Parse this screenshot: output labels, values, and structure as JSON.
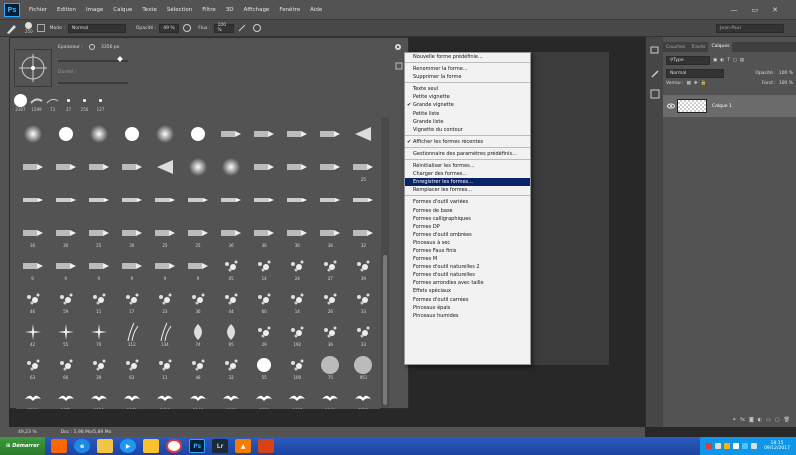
{
  "menubar": {
    "logo": "Ps",
    "items": [
      "Fichier",
      "Edition",
      "Image",
      "Calque",
      "Texte",
      "Sélection",
      "Filtre",
      "3D",
      "Affichage",
      "Fenêtre",
      "Aide"
    ],
    "window_buttons": [
      "—",
      "▭",
      "✕"
    ]
  },
  "options": {
    "brush_size": "250",
    "mode_label": "Mode :",
    "mode_value": "Normal",
    "opacity_label": "Opacité :",
    "opacity_value": "49 %",
    "flow_label": "Flux :",
    "flow_value": "100 %",
    "user": "Jean-Paul"
  },
  "brush_panel": {
    "size_label": "Epaisseur :",
    "size_value": "3356 px",
    "hardness_label": "Dureté :",
    "recent_sizes": [
      "2307",
      "1599",
      "73",
      "27",
      "256",
      "127"
    ]
  },
  "brush_grid": [
    {
      "kind": "soft",
      "num": ""
    },
    {
      "kind": "hard",
      "num": ""
    },
    {
      "kind": "soft",
      "num": ""
    },
    {
      "kind": "hard",
      "num": ""
    },
    {
      "kind": "soft",
      "num": ""
    },
    {
      "kind": "hard",
      "num": ""
    },
    {
      "kind": "bristle",
      "num": ""
    },
    {
      "kind": "bristle",
      "num": ""
    },
    {
      "kind": "bristle",
      "num": ""
    },
    {
      "kind": "bristle",
      "num": ""
    },
    {
      "kind": "fan",
      "num": ""
    },
    {
      "kind": "bristle",
      "num": ""
    },
    {
      "kind": "bristle",
      "num": ""
    },
    {
      "kind": "bristle",
      "num": ""
    },
    {
      "kind": "bristle",
      "num": ""
    },
    {
      "kind": "fan",
      "num": ""
    },
    {
      "kind": "soft",
      "num": ""
    },
    {
      "kind": "soft",
      "num": ""
    },
    {
      "kind": "bristle",
      "num": ""
    },
    {
      "kind": "bristle",
      "num": ""
    },
    {
      "kind": "bristle",
      "num": ""
    },
    {
      "kind": "bristle",
      "num": "25"
    },
    {
      "kind": "pencil",
      "num": ""
    },
    {
      "kind": "pencil",
      "num": ""
    },
    {
      "kind": "pencil",
      "num": ""
    },
    {
      "kind": "pencil",
      "num": ""
    },
    {
      "kind": "pencil",
      "num": ""
    },
    {
      "kind": "pencil",
      "num": ""
    },
    {
      "kind": "pencil",
      "num": ""
    },
    {
      "kind": "pencil",
      "num": ""
    },
    {
      "kind": "pencil",
      "num": ""
    },
    {
      "kind": "pencil",
      "num": ""
    },
    {
      "kind": "pencil",
      "num": ""
    },
    {
      "kind": "bristle",
      "num": "30"
    },
    {
      "kind": "bristle",
      "num": "30"
    },
    {
      "kind": "bristle",
      "num": "25"
    },
    {
      "kind": "bristle",
      "num": "30"
    },
    {
      "kind": "bristle",
      "num": "25"
    },
    {
      "kind": "bristle",
      "num": "25"
    },
    {
      "kind": "bristle",
      "num": "36"
    },
    {
      "kind": "bristle",
      "num": "36"
    },
    {
      "kind": "bristle",
      "num": "36"
    },
    {
      "kind": "bristle",
      "num": "36"
    },
    {
      "kind": "bristle",
      "num": "32"
    },
    {
      "kind": "bristle",
      "num": "9"
    },
    {
      "kind": "bristle",
      "num": "9"
    },
    {
      "kind": "bristle",
      "num": "9"
    },
    {
      "kind": "bristle",
      "num": "9"
    },
    {
      "kind": "bristle",
      "num": "9"
    },
    {
      "kind": "bristle",
      "num": "9"
    },
    {
      "kind": "spatter",
      "num": "45"
    },
    {
      "kind": "spatter",
      "num": "14"
    },
    {
      "kind": "spatter",
      "num": "24"
    },
    {
      "kind": "spatter",
      "num": "27"
    },
    {
      "kind": "spatter",
      "num": "39"
    },
    {
      "kind": "spatter",
      "num": "46"
    },
    {
      "kind": "spatter",
      "num": "59"
    },
    {
      "kind": "spatter",
      "num": "11"
    },
    {
      "kind": "spatter",
      "num": "17"
    },
    {
      "kind": "spatter",
      "num": "23"
    },
    {
      "kind": "spatter",
      "num": "36"
    },
    {
      "kind": "spatter",
      "num": "44"
    },
    {
      "kind": "spatter",
      "num": "60"
    },
    {
      "kind": "spatter",
      "num": "14"
    },
    {
      "kind": "spatter",
      "num": "26"
    },
    {
      "kind": "spatter",
      "num": "33"
    },
    {
      "kind": "star",
      "num": "42"
    },
    {
      "kind": "star",
      "num": "55"
    },
    {
      "kind": "star",
      "num": "70"
    },
    {
      "kind": "grass",
      "num": "112"
    },
    {
      "kind": "grass",
      "num": "134"
    },
    {
      "kind": "leaf",
      "num": "74"
    },
    {
      "kind": "leaf",
      "num": "95"
    },
    {
      "kind": "spatter",
      "num": "29"
    },
    {
      "kind": "spatter",
      "num": "192"
    },
    {
      "kind": "spatter",
      "num": "36"
    },
    {
      "kind": "spatter",
      "num": "33"
    },
    {
      "kind": "spatter",
      "num": "63"
    },
    {
      "kind": "spatter",
      "num": "66"
    },
    {
      "kind": "spatter",
      "num": "39"
    },
    {
      "kind": "spatter",
      "num": "63"
    },
    {
      "kind": "spatter",
      "num": "11"
    },
    {
      "kind": "spatter",
      "num": "48"
    },
    {
      "kind": "spatter",
      "num": "32"
    },
    {
      "kind": "hard",
      "num": "55"
    },
    {
      "kind": "spatter",
      "num": "100"
    },
    {
      "kind": "grayball",
      "num": "75"
    },
    {
      "kind": "grayball",
      "num": "951"
    },
    {
      "kind": "bird",
      "num": "2108"
    },
    {
      "kind": "bird",
      "num": "2672"
    },
    {
      "kind": "bird",
      "num": "2556"
    },
    {
      "kind": "bird",
      "num": "1979"
    },
    {
      "kind": "bird",
      "num": "2990"
    },
    {
      "kind": "bird",
      "num": "1348"
    },
    {
      "kind": "bird",
      "num": "1999"
    },
    {
      "kind": "bird",
      "num": "1999"
    },
    {
      "kind": "bird",
      "num": "1687"
    },
    {
      "kind": "bird",
      "num": "1390"
    },
    {
      "kind": "bird",
      "num": "2831"
    },
    {
      "kind": "sig",
      "num": "2008"
    },
    {
      "kind": "sig",
      "num": "1686"
    },
    {
      "kind": "texture",
      "num": "2296"
    },
    {
      "kind": "texture",
      "num": "2081"
    },
    {
      "kind": "texture",
      "num": "2227"
    },
    {
      "kind": "texture",
      "num": "2217"
    },
    {
      "kind": "texture",
      "num": "2590"
    },
    {
      "kind": "texture",
      "num": "2560"
    },
    {
      "kind": "texture",
      "num": "1537"
    },
    {
      "kind": "texture",
      "num": "1567"
    }
  ],
  "menu": {
    "groups": [
      [
        {
          "label": "Nouvelle forme prédéfinie..."
        }
      ],
      [
        {
          "label": "Renommer la forme..."
        },
        {
          "label": "Supprimer la forme"
        }
      ],
      [
        {
          "label": "Texte seul"
        },
        {
          "label": "Petite vignette"
        },
        {
          "label": "Grande vignette",
          "checked": true
        },
        {
          "label": "Petite liste"
        },
        {
          "label": "Grande liste"
        },
        {
          "label": "Vignette du contour"
        }
      ],
      [
        {
          "label": "Afficher les formes récentes",
          "checked": true
        }
      ],
      [
        {
          "label": "Gestionnaire des paramètres prédéfinis..."
        }
      ],
      [
        {
          "label": "Réinitialiser les formes..."
        },
        {
          "label": "Charger des formes..."
        },
        {
          "label": "Enregistrer les formes...",
          "highlight": true
        },
        {
          "label": "Remplacer les formes..."
        }
      ],
      [
        {
          "label": "Formes d'outil variées"
        },
        {
          "label": "Formes de base"
        },
        {
          "label": "Formes calligraphiques"
        },
        {
          "label": "Formes DP"
        },
        {
          "label": "Formes d'outil ombrées"
        },
        {
          "label": "Pinceaux à sec"
        },
        {
          "label": "Formes Faux finis"
        },
        {
          "label": "Formes M"
        },
        {
          "label": "Formes d'outil naturelles 2"
        },
        {
          "label": "Formes d'outil naturelles"
        },
        {
          "label": "Formes arrondies avec taille"
        },
        {
          "label": "Effets spéciaux"
        },
        {
          "label": "Formes d'outil carrées"
        },
        {
          "label": "Pinceaux épais"
        },
        {
          "label": "Pinceaux humides"
        }
      ]
    ]
  },
  "layers_panel": {
    "tabs": [
      "Couches",
      "Tracés",
      "Calques"
    ],
    "filter": "Type",
    "blend_mode": "Normal",
    "opacity_label": "Opacité :",
    "opacity_value": "100 %",
    "lock_label": "Verrou :",
    "fill_label": "Fond :",
    "fill_value": "100 %",
    "layer_name": "Calque 1"
  },
  "status": {
    "zoom": "49,23 %",
    "doc": "Doc : 5,98 Mo/5,89 Mo"
  },
  "taskbar": {
    "start": "Démarrer",
    "time": "18:15",
    "date": "09/12/2017"
  }
}
